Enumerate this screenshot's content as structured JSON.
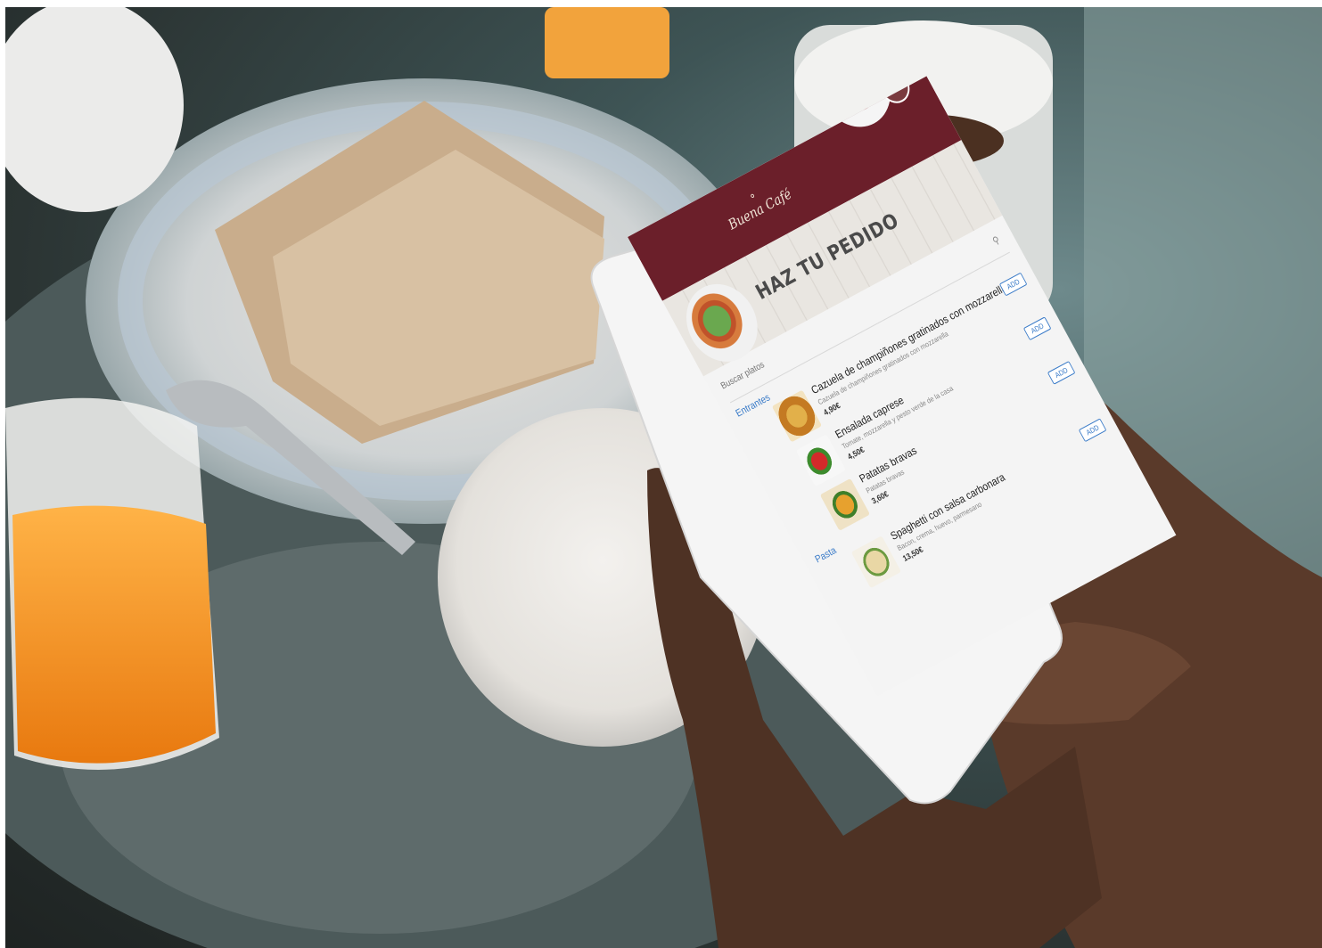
{
  "app": {
    "brand": "Buena Café",
    "hero_title": "HAZ TU PEDIDO",
    "search_placeholder": "Buscar platos",
    "accent_color": "#6b1f2a",
    "link_color": "#3a7bc8"
  },
  "sections": [
    {
      "label": "Entrantes"
    },
    {
      "label": "Pasta"
    }
  ],
  "items": [
    {
      "name": "Cazuela de champiñones gratinados con mozzarella",
      "desc": "Cazuela de champiñones gratinados con mozzarella",
      "price": "4,90€",
      "add_label": "ADD"
    },
    {
      "name": "Ensalada caprese",
      "desc": "Tomate, mozzarella y pesto verde de la casa",
      "price": "4,50€",
      "add_label": "ADD"
    },
    {
      "name": "Patatas bravas",
      "desc": "Patatas bravas",
      "price": "3,60€",
      "add_label": "ADD"
    },
    {
      "name": "Spaghetti con salsa carbonara",
      "desc": "Bacon, crema, huevo, parmesano",
      "price": "13,50€",
      "add_label": "ADD"
    }
  ]
}
